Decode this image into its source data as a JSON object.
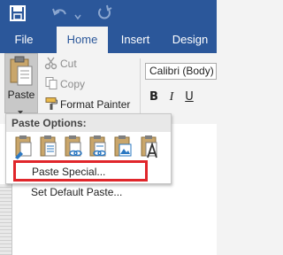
{
  "quick_access": {
    "icons": [
      "save-icon",
      "undo-icon",
      "redo-icon"
    ]
  },
  "tabs": [
    {
      "label": "File",
      "active": false
    },
    {
      "label": "Home",
      "active": true
    },
    {
      "label": "Insert",
      "active": false
    },
    {
      "label": "Design",
      "active": false
    }
  ],
  "clipboard": {
    "paste_label": "Paste",
    "cut_label": "Cut",
    "copy_label": "Copy",
    "format_painter_label": "Format Painter"
  },
  "font": {
    "name": "Calibri (Body)",
    "bold_label": "B",
    "italic_label": "I",
    "underline_label": "U"
  },
  "paste_menu": {
    "header": "Paste Options:",
    "options": [
      "keep-source-formatting-icon",
      "merge-formatting-icon",
      "picture-icon",
      "keep-text-only-icon"
    ],
    "items": [
      {
        "label": "Paste Special...",
        "highlighted": true
      },
      {
        "label": "Set Default Paste...",
        "highlighted": false
      }
    ]
  },
  "colors": {
    "title_bar": "#2b579a",
    "ribbon": "#f3f3f3",
    "highlight": "#e0262b"
  }
}
